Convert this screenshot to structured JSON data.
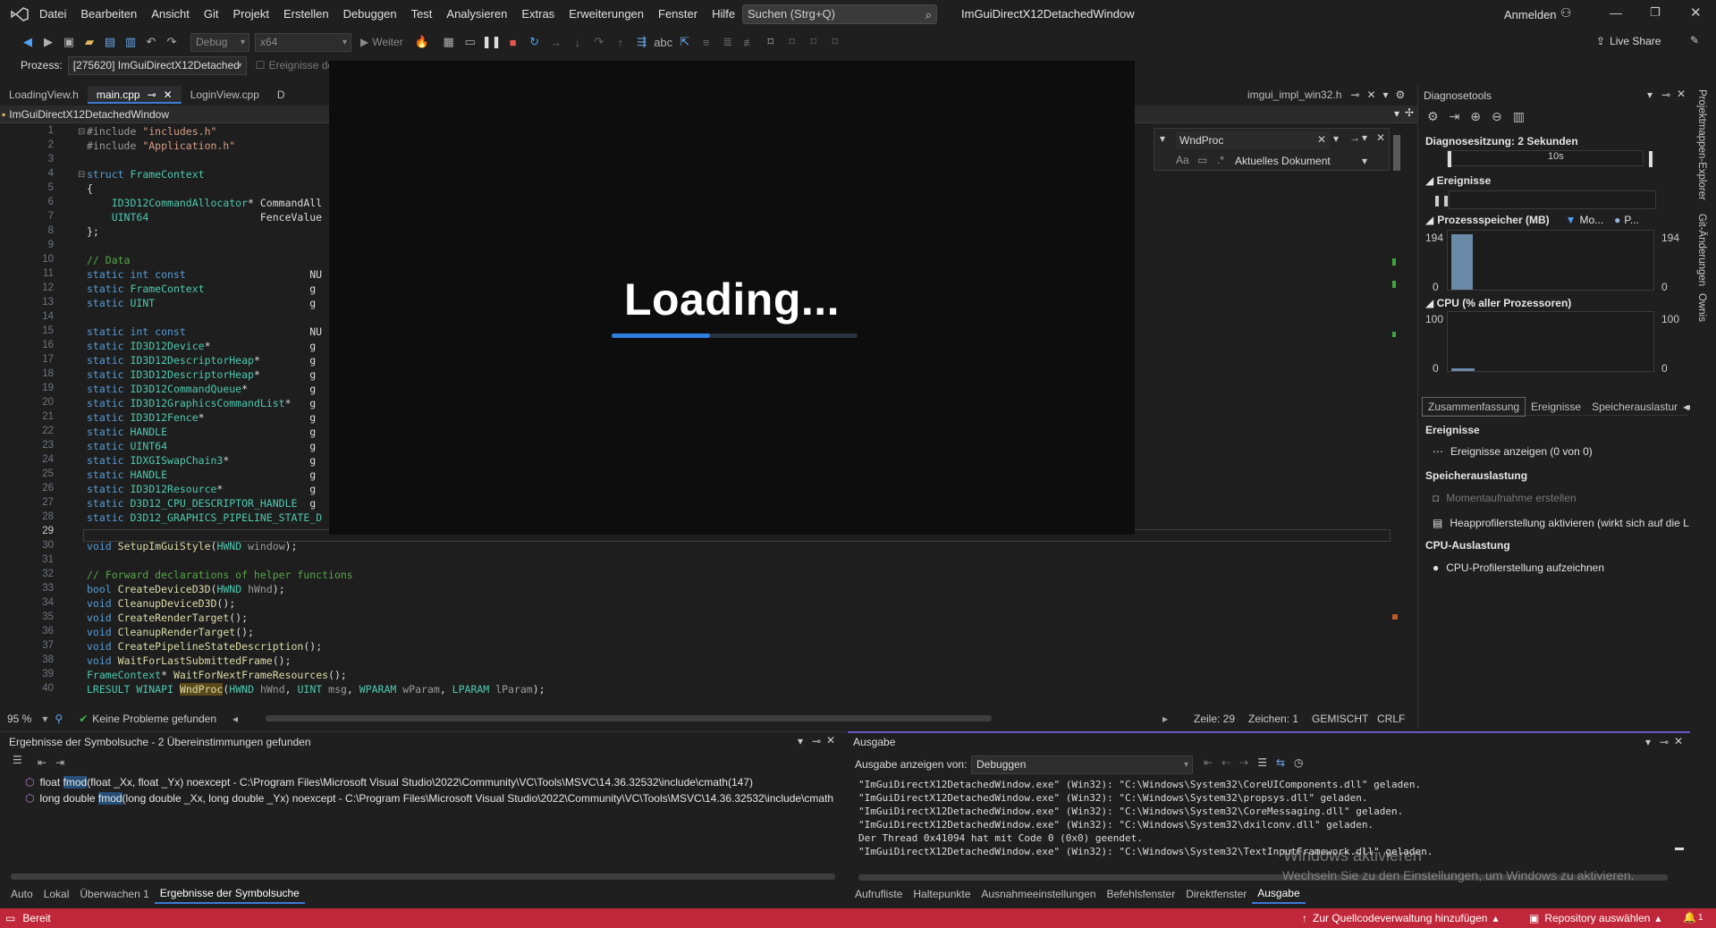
{
  "app": {
    "menu": [
      "Datei",
      "Bearbeiten",
      "Ansicht",
      "Git",
      "Projekt",
      "Erstellen",
      "Debuggen",
      "Test",
      "Analysieren",
      "Extras",
      "Erweiterungen",
      "Fenster",
      "Hilfe"
    ],
    "search_placeholder": "Suchen (Strg+Q)",
    "solution_name": "ImGuiDirectX12DetachedWindow",
    "signin": "Anmelden",
    "live_share": "Live Share"
  },
  "toolbar": {
    "config": "Debug",
    "platform": "x64",
    "continue": "Weiter",
    "process_label": "Prozess:",
    "process_value": "[275620] ImGuiDirectX12Detached",
    "events_label": "Ereignisse de"
  },
  "tabs": [
    {
      "label": "LoadingView.h"
    },
    {
      "label": "main.cpp"
    },
    {
      "label": "LoginView.cpp"
    },
    {
      "label": "D"
    }
  ],
  "tab_right": "imgui_impl_win32.h",
  "navbar": {
    "scope": "ImGuiDirectX12DetachedWindow"
  },
  "find": {
    "query": "WndProc",
    "scope": "Aktuelles Dokument"
  },
  "loading": {
    "text": "Loading...",
    "progress": 0.4
  },
  "code": [
    {
      "n": "1",
      "html": "<span class='p'>#include</span> <span class='s'>\"includes.h\"</span>"
    },
    {
      "n": "2",
      "html": "<span class='p'>#include</span> <span class='s'>\"Application.h\"</span>"
    },
    {
      "n": "3",
      "html": ""
    },
    {
      "n": "4",
      "html": "<span class='k'>struct</span> <span class='t'>FrameContext</span>"
    },
    {
      "n": "5",
      "html": "{"
    },
    {
      "n": "6",
      "html": "    <span class='t'>ID3D12CommandAllocator</span>* CommandAll"
    },
    {
      "n": "7",
      "html": "    <span class='t'>UINT64</span>                  FenceValue"
    },
    {
      "n": "8",
      "html": "};"
    },
    {
      "n": "9",
      "html": ""
    },
    {
      "n": "10",
      "html": "<span class='c'>// Data</span>"
    },
    {
      "n": "11",
      "html": "<span class='k'>static int const</span>                    NU"
    },
    {
      "n": "12",
      "html": "<span class='k'>static</span> <span class='t'>FrameContext</span>                 g"
    },
    {
      "n": "13",
      "html": "<span class='k'>static</span> <span class='t'>UINT</span>                         g"
    },
    {
      "n": "14",
      "html": ""
    },
    {
      "n": "15",
      "html": "<span class='k'>static int const</span>                    NU"
    },
    {
      "n": "16",
      "html": "<span class='k'>static</span> <span class='t'>ID3D12Device</span>*                g"
    },
    {
      "n": "17",
      "html": "<span class='k'>static</span> <span class='t'>ID3D12DescriptorHeap</span>*        g"
    },
    {
      "n": "18",
      "html": "<span class='k'>static</span> <span class='t'>ID3D12DescriptorHeap</span>*        g"
    },
    {
      "n": "19",
      "html": "<span class='k'>static</span> <span class='t'>ID3D12CommandQueue</span>*          g"
    },
    {
      "n": "20",
      "html": "<span class='k'>static</span> <span class='t'>ID3D12GraphicsCommandList</span>*   g"
    },
    {
      "n": "21",
      "html": "<span class='k'>static</span> <span class='t'>ID3D12Fence</span>*                 g"
    },
    {
      "n": "22",
      "html": "<span class='k'>static</span> <span class='t'>HANDLE</span>                       g"
    },
    {
      "n": "23",
      "html": "<span class='k'>static</span> <span class='t'>UINT64</span>                       g"
    },
    {
      "n": "24",
      "html": "<span class='k'>static</span> <span class='t'>IDXGISwapChain3</span>*             g"
    },
    {
      "n": "25",
      "html": "<span class='k'>static</span> <span class='t'>HANDLE</span>                       g"
    },
    {
      "n": "26",
      "html": "<span class='k'>static</span> <span class='t'>ID3D12Resource</span>*              g"
    },
    {
      "n": "27",
      "html": "<span class='k'>static</span> <span class='t'>D3D12_CPU_DESCRIPTOR_HANDLE</span>  g"
    },
    {
      "n": "28",
      "html": "<span class='k'>static</span> <span class='t'>D3D12_GRAPHICS_PIPELINE_STATE_D</span>"
    },
    {
      "n": "29",
      "html": ""
    },
    {
      "n": "30",
      "html": "<span class='k'>void</span> <span class='f'>SetupImGuiStyle</span>(<span class='t'>HWND</span> <span class='p'>window</span>);"
    },
    {
      "n": "31",
      "html": ""
    },
    {
      "n": "32",
      "html": "<span class='c'>// Forward declarations of helper functions</span>"
    },
    {
      "n": "33",
      "html": "<span class='k'>bool</span> <span class='f'>CreateDeviceD3D</span>(<span class='t'>HWND</span> <span class='p'>hWnd</span>);"
    },
    {
      "n": "34",
      "html": "<span class='k'>void</span> <span class='f'>CleanupDeviceD3D</span>();"
    },
    {
      "n": "35",
      "html": "<span class='k'>void</span> <span class='f'>CreateRenderTarget</span>();"
    },
    {
      "n": "36",
      "html": "<span class='k'>void</span> <span class='f'>CleanupRenderTarget</span>();"
    },
    {
      "n": "37",
      "html": "<span class='k'>void</span> <span class='f'>CreatePipelineStateDescription</span>();"
    },
    {
      "n": "38",
      "html": "<span class='k'>void</span> <span class='f'>WaitForLastSubmittedFrame</span>();"
    },
    {
      "n": "39",
      "html": "<span class='t'>FrameContext</span>* <span class='f'>WaitForNextFrameResources</span>();"
    },
    {
      "n": "40",
      "html": "<span class='t'>LRESULT</span> <span class='t'>WINAPI</span> <span class='f' style='background:#5c4a1a'>WndProc</span>(<span class='t'>HWND</span> <span class='p'>hWnd</span>, <span class='t'>UINT</span> <span class='p'>msg</span>, <span class='t'>WPARAM</span> <span class='p'>wParam</span>, <span class='t'>LPARAM</span> <span class='p'>lParam</span>);"
    }
  ],
  "editor_status": {
    "zoom": "95 %",
    "problems": "Keine Probleme gefunden",
    "line": "Zeile: 29",
    "col": "Zeichen: 1",
    "mode": "GEMISCHT",
    "eol": "CRLF"
  },
  "diag": {
    "title": "Diagnosetools",
    "session": "Diagnosesitzung: 2 Sekunden",
    "timeline_label": "10s",
    "events_title": "Ereignisse",
    "mem_title": "Prozessspeicher (MB)",
    "mem_legend1": "Mo...",
    "mem_legend2": "P...",
    "mem_max": "194",
    "mem_min": "0",
    "cpu_title": "CPU (% aller Prozessoren)",
    "cpu_max": "100",
    "cpu_min": "0",
    "tabs": [
      "Zusammenfassung",
      "Ereignisse",
      "Speicherauslastur"
    ],
    "sec_events": "Ereignisse",
    "show_events": "Ereignisse anzeigen (0 von 0)",
    "sec_mem": "Speicherauslastung",
    "snapshot": "Momentaufnahme erstellen",
    "heap": "Heapprofilerstellung aktivieren (wirkt sich auf die L",
    "sec_cpu": "CPU-Auslastung",
    "cpu_rec": "CPU-Profilerstellung aufzeichnen"
  },
  "side": {
    "a": "Projektmappen-Explorer",
    "b": "Git-Änderungen",
    "c": "Ownis"
  },
  "symres": {
    "title": "Ergebnisse der Symbolsuche - 2 Übereinstimmungen gefunden",
    "r1_pre": "float ",
    "r1_hl": "fmod",
    "r1_post": "(float _Xx, float _Yx) noexcept - C:\\Program Files\\Microsoft Visual Studio\\2022\\Community\\VC\\Tools\\MSVC\\14.36.32532\\include\\cmath(147)",
    "r2_pre": "long double ",
    "r2_hl": "fmod",
    "r2_post": "(long double _Xx, long double _Yx) noexcept - C:\\Program Files\\Microsoft Visual Studio\\2022\\Community\\VC\\Tools\\MSVC\\14.36.32532\\include\\cmath",
    "tabs": [
      "Auto",
      "Lokal",
      "Überwachen 1",
      "Ergebnisse der Symbolsuche"
    ]
  },
  "output": {
    "title": "Ausgabe",
    "show_label": "Ausgabe anzeigen von:",
    "source": "Debuggen",
    "lines": [
      "\"ImGuiDirectX12DetachedWindow.exe\" (Win32): \"C:\\Windows\\System32\\CoreUIComponents.dll\" geladen.",
      "\"ImGuiDirectX12DetachedWindow.exe\" (Win32): \"C:\\Windows\\System32\\propsys.dll\" geladen.",
      "\"ImGuiDirectX12DetachedWindow.exe\" (Win32): \"C:\\Windows\\System32\\CoreMessaging.dll\" geladen.",
      "\"ImGuiDirectX12DetachedWindow.exe\" (Win32): \"C:\\Windows\\System32\\dxilconv.dll\" geladen.",
      "Der Thread 0x41094 hat mit Code 0 (0x0) geendet.",
      "\"ImGuiDirectX12DetachedWindow.exe\" (Win32): \"C:\\Windows\\System32\\TextInputFramework.dll\" geladen."
    ],
    "tabs": [
      "Aufrufliste",
      "Haltepunkte",
      "Ausnahmeeinstellungen",
      "Befehlsfenster",
      "Direktfenster",
      "Ausgabe"
    ]
  },
  "watermark": {
    "line1": "Windows aktivieren",
    "line2": "Wechseln Sie zu den Einstellungen, um Windows zu aktivieren."
  },
  "statusbar": {
    "ready": "Bereit",
    "source_control": "Zur Quellcodeverwaltung hinzufügen",
    "repo": "Repository auswählen",
    "bell_count": "1"
  }
}
